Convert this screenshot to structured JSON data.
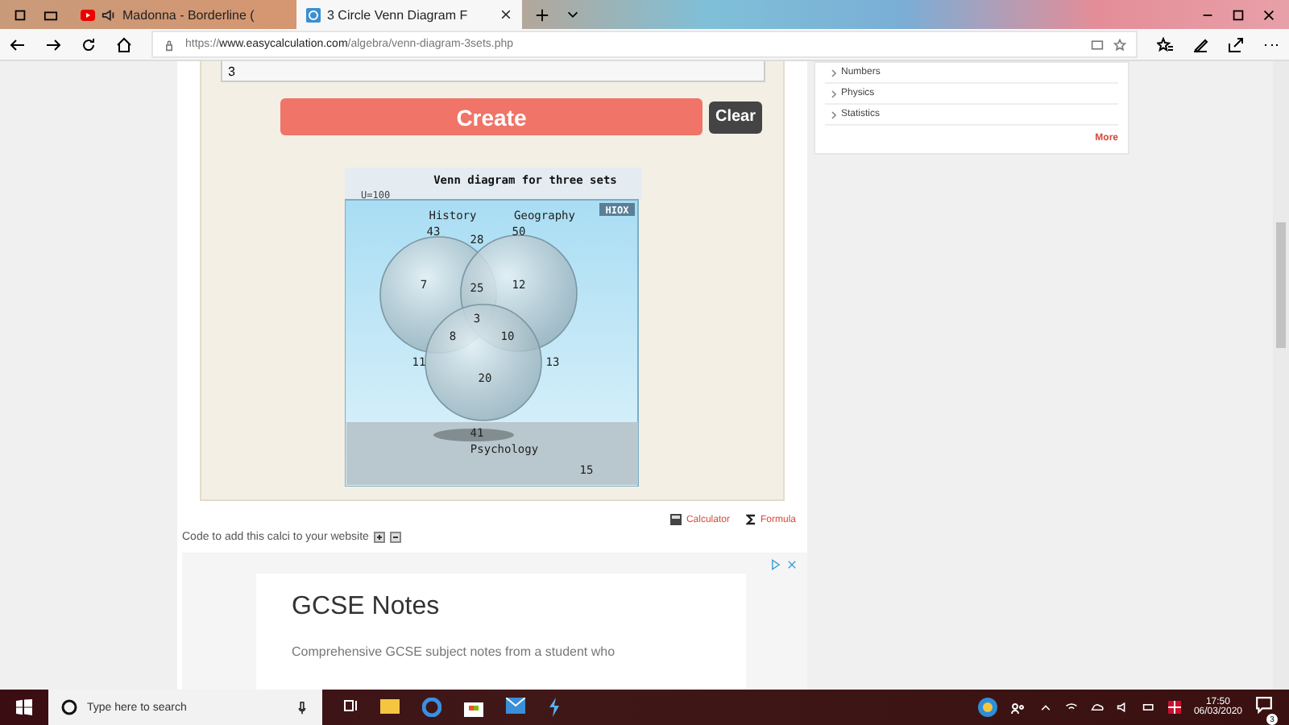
{
  "browser": {
    "tabs": [
      {
        "title": "Madonna - Borderline (",
        "selected": false,
        "kind": "video"
      },
      {
        "title": "3 Circle Venn Diagram F",
        "selected": true,
        "kind": "page"
      }
    ],
    "url_prefix": "https://",
    "url_host": "www.easycalculation.com",
    "url_path": "/algebra/venn-diagram-3sets.php"
  },
  "form": {
    "input_value": "3",
    "create_button": "Create",
    "clear_button": "Clear"
  },
  "venn": {
    "title": "Venn diagram for three sets",
    "universe": "U=100",
    "badge": "HIOX",
    "sets": [
      "History",
      "Geography",
      "Psychology"
    ],
    "values": [
      "43",
      "28",
      "50",
      "7",
      "25",
      "12",
      "3",
      "8",
      "10",
      "11",
      "13",
      "20",
      "41",
      "15"
    ]
  },
  "tools": [
    {
      "label": "Calculator",
      "kind": "calculator"
    },
    {
      "label": "Formula",
      "kind": "formula"
    }
  ],
  "embed_text": "Code to add this calci to your website",
  "ad": {
    "title": "GCSE Notes",
    "text": "Comprehensive GCSE subject notes from a student who"
  },
  "sidebar": {
    "links": [
      "Numbers",
      "Physics",
      "Statistics"
    ],
    "more": "More"
  },
  "taskbar": {
    "search_placeholder": "Type here to search",
    "time": "17:50",
    "date": "06/03/2020",
    "notifications": "3"
  }
}
